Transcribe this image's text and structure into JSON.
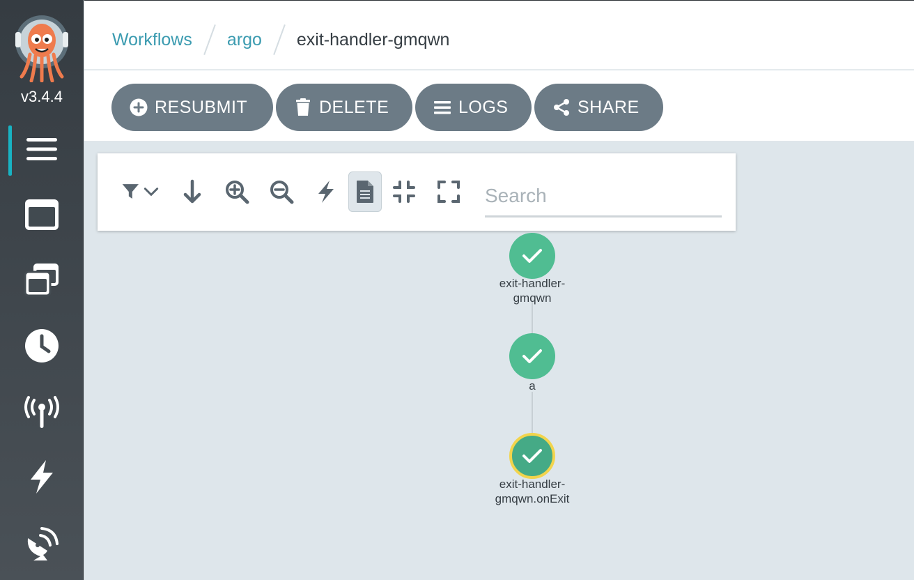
{
  "sidebar": {
    "version": "v3.4.4",
    "items": [
      {
        "icon": "menu-icon"
      },
      {
        "icon": "window-icon"
      },
      {
        "icon": "stacked-windows-icon"
      },
      {
        "icon": "clock-icon"
      },
      {
        "icon": "antenna-icon"
      },
      {
        "icon": "lightning-icon"
      },
      {
        "icon": "satellite-dish-icon"
      }
    ],
    "active_accent": "#18b3c3"
  },
  "breadcrumb": {
    "items": [
      "Workflows",
      "argo"
    ],
    "current": "exit-handler-gmqwn"
  },
  "toolbar": {
    "resubmit_label": "RESUBMIT",
    "delete_label": "DELETE",
    "logs_label": "LOGS",
    "share_label": "SHARE"
  },
  "graph_toolbar": {
    "search_placeholder": "Search",
    "icons": [
      "filter-icon",
      "chevron-down-icon",
      "arrow-down-icon",
      "zoom-in-icon",
      "zoom-out-icon",
      "lightning-icon",
      "document-icon",
      "compress-icon",
      "expand-icon"
    ]
  },
  "graph": {
    "nodes": [
      {
        "label": "exit-handler-\ngmqwn",
        "status": "succeeded"
      },
      {
        "label": "a",
        "status": "succeeded"
      },
      {
        "label": "exit-handler-\ngmqwn.onExit",
        "status": "succeeded"
      }
    ],
    "colors": {
      "succeeded": "#50bd92",
      "selected_ring": "#f2d44c"
    }
  }
}
